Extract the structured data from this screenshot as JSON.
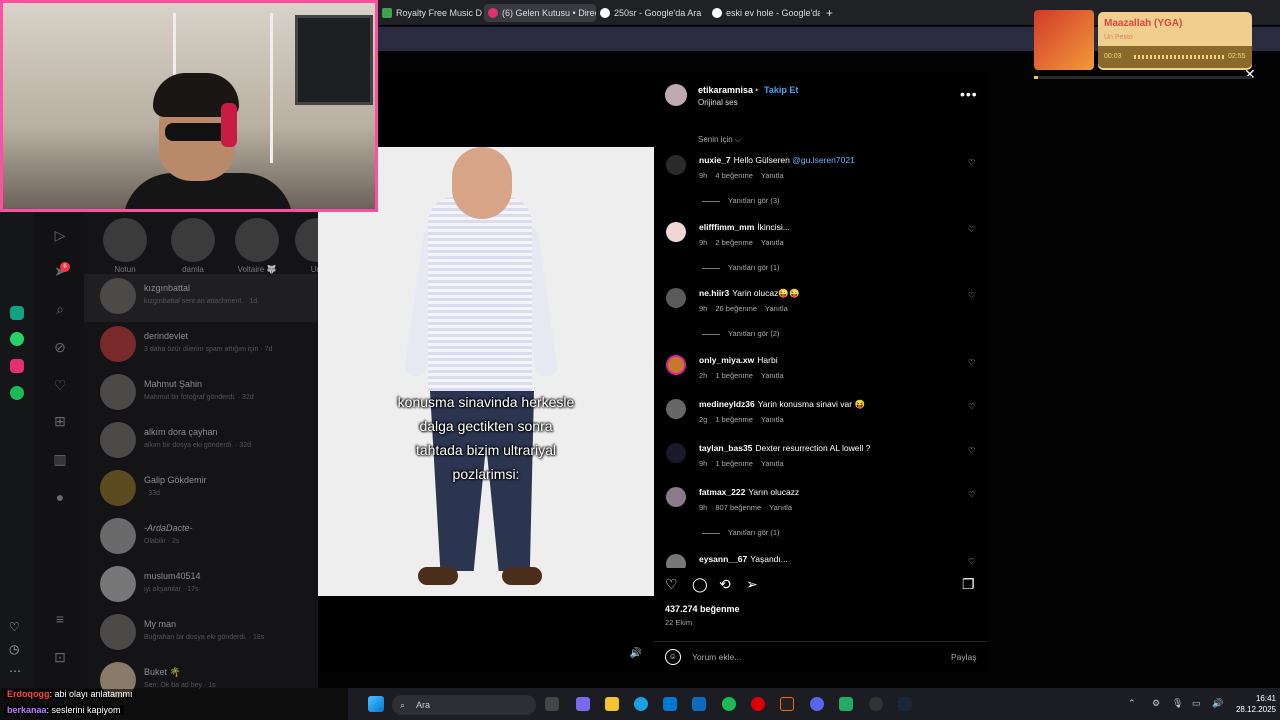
{
  "browser": {
    "tabs": [
      {
        "label": "Royalty Free Music Downl...",
        "color": "#3fa34d"
      },
      {
        "label": "(6) Gelen Kutusu • Direct",
        "color": "#e1306c"
      },
      {
        "label": "250sr - Google'da Ara",
        "color": "#4285f4"
      },
      {
        "label": "eski ev hole - Google'da A",
        "color": "#4285f4"
      }
    ],
    "new_tab": "+"
  },
  "dm_sidebar": {
    "badge": "6"
  },
  "stories": [
    {
      "label": "Notun"
    },
    {
      "label": "damla"
    },
    {
      "label": "Voltaire 🐺"
    },
    {
      "label": "Um"
    }
  ],
  "threads": [
    {
      "name": "kızgınbattal",
      "preview": "kızgınbattal sent an attachment. · 1d"
    },
    {
      "name": "derindevlet",
      "preview": "3 daha özür dilerim spam attığım için · 7d"
    },
    {
      "name": "Mahmut Şahin",
      "preview": "Mahmut bir fotoğraf gönderdi. · 32d"
    },
    {
      "name": "alkım dora çayhan",
      "preview": "alkım bir dosya eki gönderdi. · 32d"
    },
    {
      "name": "Galip Gökdemir",
      "preview": "· 33d"
    },
    {
      "name": "-ArdaDacte-",
      "preview": "Olabilir · 2s"
    },
    {
      "name": "muslum40514",
      "preview": "iyi akşamlar · 17s"
    },
    {
      "name": "My man",
      "preview": "Buğrahan bir dosya eki gönderdi. · 18s"
    },
    {
      "name": "Buket 🌴",
      "preview": "Sen: Ok ba ad bey · 1s"
    }
  ],
  "post": {
    "username": "etikaramnisa",
    "follow": "Takip Et",
    "audio": "Orijinal ses",
    "caption_overlay": "konusma sinavinda herkesle\ndalga gectikten sonra\ntahtada bizim ultrariyal\npozlarimsi:",
    "sort_label": "Senin için ⌵",
    "likes": "437.274 beğenme",
    "date": "22 Ekim",
    "comment_placeholder": "Yorum ekle...",
    "post_button": "Paylaş"
  },
  "comments": [
    {
      "user": "nuxie_7",
      "text": "Hello Gülseren",
      "mention": "@gu.lseren7021",
      "time": "9h",
      "likes": "4 beğenme",
      "reply": "Yanıtla",
      "replies": "Yanıtları gör (3)"
    },
    {
      "user": "elifffimm_mm",
      "text": "İkincisi...",
      "mention": "",
      "time": "9h",
      "likes": "2 beğenme",
      "reply": "Yanıtla",
      "replies": "Yanıtları gör (1)"
    },
    {
      "user": "ne.hiir3",
      "text": "Yarin olucaz😜😜",
      "mention": "",
      "time": "9h",
      "likes": "26 beğenme",
      "reply": "Yanıtla",
      "replies": "Yanıtları gör (2)"
    },
    {
      "user": "only_miya.xw",
      "text": "Harbi",
      "mention": "",
      "time": "2h",
      "likes": "1 beğenme",
      "reply": "Yanıtla",
      "replies": ""
    },
    {
      "user": "medineyldz36",
      "text": "Yarin konusma sinavi var 😝",
      "mention": "",
      "time": "2g",
      "likes": "1 beğenme",
      "reply": "Yanıtla",
      "replies": ""
    },
    {
      "user": "taylan_bas35",
      "text": "Dexter resurrection AL lowell ?",
      "mention": "",
      "time": "9h",
      "likes": "1 beğenme",
      "reply": "Yanıtla",
      "replies": ""
    },
    {
      "user": "fatmax_222",
      "text": "Yarın olucazz",
      "mention": "",
      "time": "9h",
      "likes": "807 beğenme",
      "reply": "Yanıtla",
      "replies": "Yanıtları gör (1)"
    },
    {
      "user": "eysann__67",
      "text": "Yaşandı...",
      "mention": "",
      "time": "",
      "likes": "",
      "reply": "",
      "replies": ""
    }
  ],
  "spotify": {
    "title": "Maazallah (YGA)",
    "artist": "Un Pesto",
    "elapsed": "00:03",
    "total": "02:55",
    "progress": 0.02
  },
  "chat": [
    {
      "user": "Erdoqogg",
      "message": ": abi olayı anlatammı"
    },
    {
      "user": "berkanaa",
      "message": ": seslerini kapiyom"
    }
  ],
  "taskbar": {
    "search_placeholder": "Ara",
    "time": "16:41",
    "date": "28.12.2025"
  }
}
